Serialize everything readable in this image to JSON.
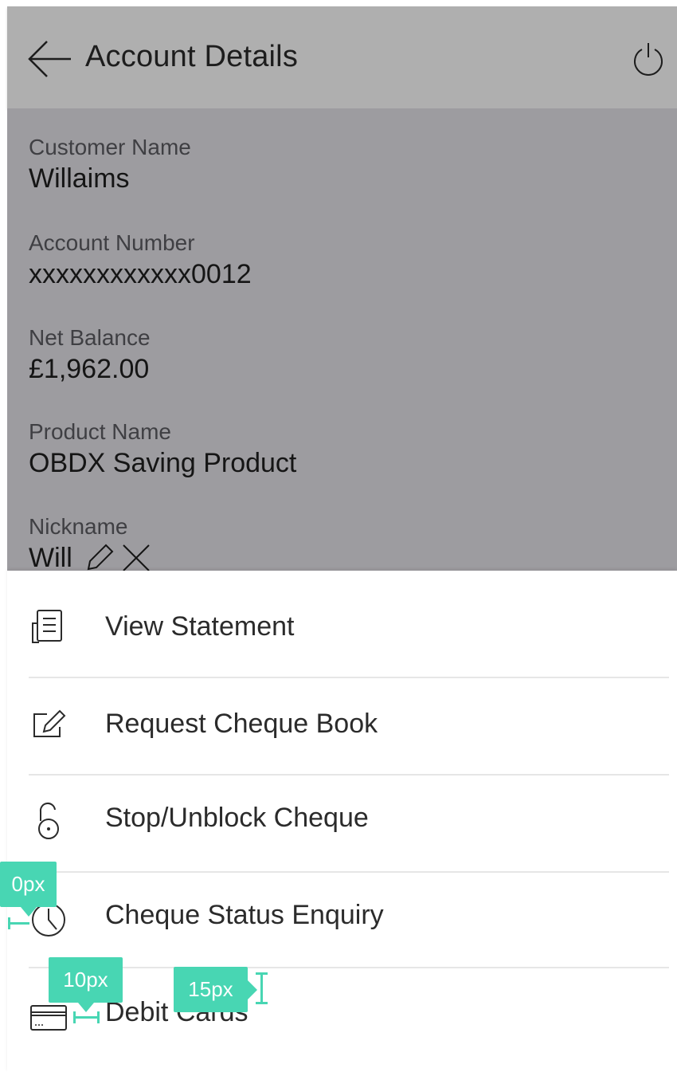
{
  "header": {
    "title": "Account Details",
    "back_icon": "arrow-left-icon",
    "power_icon": "power-icon"
  },
  "fields": [
    {
      "label": "Customer Name",
      "value": "Willaims"
    },
    {
      "label": "Account Number",
      "value": "xxxxxxxxxxxx0012"
    },
    {
      "label": "Net Balance",
      "value": "£1,962.00"
    },
    {
      "label": "Product Name",
      "value": "OBDX Saving Product"
    },
    {
      "label": "Nickname",
      "value": "Will"
    }
  ],
  "menu": [
    {
      "label": "View Statement",
      "icon": "statement-icon"
    },
    {
      "label": "Request Cheque Book",
      "icon": "edit-box-icon"
    },
    {
      "label": "Stop/Unblock Cheque",
      "icon": "unlock-icon"
    },
    {
      "label": "Cheque Status Enquiry",
      "icon": "clock-icon"
    },
    {
      "label": "Debit Cards",
      "icon": "card-icon"
    }
  ],
  "annotations": {
    "left_gap": "0px",
    "icon_gap": "10px",
    "text_offset": "15px"
  },
  "colors": {
    "header_bg": "#afafaf",
    "overlay_bg": "#9d9ca0",
    "accent_annotation": "#48d6b3",
    "divider": "#e6e6e6"
  }
}
